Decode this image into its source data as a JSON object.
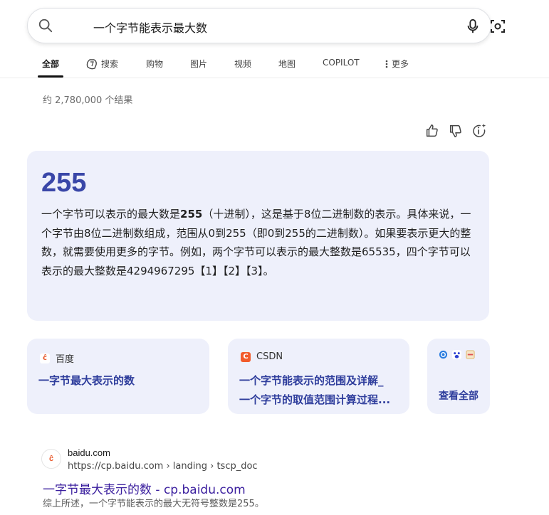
{
  "search": {
    "query": "一个字节能表示最大数"
  },
  "tabs": [
    {
      "label": "全部"
    },
    {
      "label": "搜索"
    },
    {
      "label": "购物"
    },
    {
      "label": "图片"
    },
    {
      "label": "视频"
    },
    {
      "label": "地图"
    },
    {
      "label": "COPILOT"
    },
    {
      "label": "更多"
    }
  ],
  "results_count": "约 2,780,000 个结果",
  "answer": {
    "big_number": "255",
    "text_before": "一个字节可以表示的最大数是",
    "text_bold": "255",
    "text_after": "（十进制），这是基于8位二进制数的表示。具体来说，一个字节由8位二进制数组成，范围从0到255（即0到255的二进制数）。如果要表示更大的整数，就需要使用更多的字节。例如，两个字节可以表示的最大整数是65535，四个字节可以表示的最大整数是4294967295【1】【2】【3】。"
  },
  "sources": [
    {
      "site": "百度",
      "icon": "baidu-icon",
      "title_line1": "一字节最大表示的数",
      "title_line2": ""
    },
    {
      "site": "CSDN",
      "icon": "csdn-icon",
      "title_line1": "一个字节能表示的范围及详解_",
      "title_line2": "一个字节的取值范围计算过程..."
    }
  ],
  "more_sources": {
    "label": "查看全部"
  },
  "result": {
    "site": "baidu.com",
    "url": "https://cp.baidu.com › landing › tscp_doc",
    "title": "一字节最大表示的数 - cp.baidu.com",
    "snippet": "综上所述，一个字节能表示的最大无符号整数是255。"
  },
  "colors": {
    "accent": "#3a47a8",
    "card_bg": "#eef0fb",
    "link": "#3a1e9e"
  }
}
